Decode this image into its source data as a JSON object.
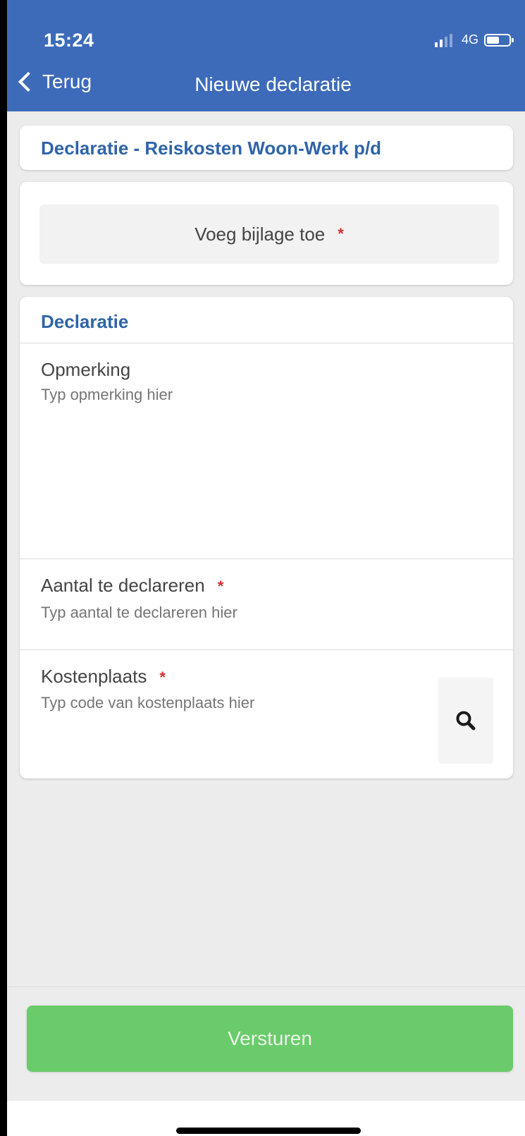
{
  "status_bar": {
    "time": "15:24",
    "network": "4G",
    "signal_bars_active": 2,
    "signal_bars_total": 4,
    "battery_level": 0.55
  },
  "nav": {
    "back_label": "Terug",
    "title": "Nieuwe declaratie"
  },
  "type_card": {
    "title": "Declaratie - Reiskosten Woon-Werk p/d"
  },
  "attachment": {
    "label": "Voeg bijlage toe",
    "required_marker": "*"
  },
  "form": {
    "section_title": "Declaratie",
    "fields": [
      {
        "label": "Opmerking",
        "placeholder": "Typ opmerking hier",
        "value": "",
        "required": false
      },
      {
        "label": "Aantal te declareren",
        "placeholder": "Typ aantal te declareren hier",
        "value": "",
        "required": true,
        "required_marker": "*"
      },
      {
        "label": "Kostenplaats",
        "placeholder": "Typ code van kostenplaats hier",
        "value": "",
        "required": true,
        "required_marker": "*",
        "action_icon": "search-icon"
      }
    ]
  },
  "footer": {
    "submit_label": "Versturen"
  },
  "colors": {
    "header_bg": "#3d6bba",
    "accent_text": "#2f64a8",
    "required": "#d32f2f",
    "submit_bg": "#6acb6b",
    "page_bg": "#ececec"
  }
}
